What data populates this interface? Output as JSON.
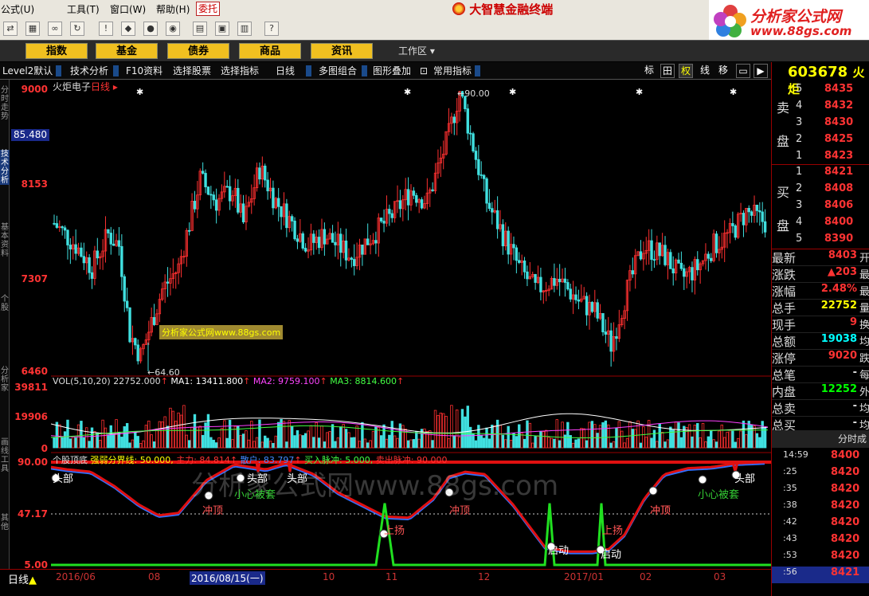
{
  "menu": [
    "公式(U)",
    "工具(T)",
    "窗口(W)",
    "帮助(H)"
  ],
  "entrust_label": "委托",
  "app_title": "大智慧金融终端",
  "logo": {
    "name": "分析家公式网",
    "url": "www.88gs.com"
  },
  "nav": [
    "指数",
    "基金",
    "债券",
    "商品",
    "资讯"
  ],
  "workarea_label": "工作区",
  "tabs": [
    "Level2默认",
    "技术分析",
    "F10资料",
    "选择股票",
    "选择指标",
    "日线",
    "多图组合",
    "图形叠加",
    "常用指标"
  ],
  "right_buttons": [
    "标",
    "田",
    "权",
    "线",
    "移"
  ],
  "side_labels": [
    "分时走势",
    "技术分析",
    "基本资料",
    "个股",
    "分析家",
    "画线工具",
    "其他"
  ],
  "price_axis": [
    "9000",
    "8153",
    "7307",
    "6460"
  ],
  "cursor_value": "85.480",
  "chart_title": "火炬电子",
  "chart_period": "日线",
  "price_markers": {
    "high": "90.00",
    "low": "64.60"
  },
  "watermark_box": "分析家公式网www.88gs.com",
  "vol_header": {
    "name": "VOL(5,10,20)",
    "vol": "22752.000",
    "ma1": "MA1: 13411.800",
    "ma2": "MA2: 9759.100",
    "ma3": "MA3: 8814.600"
  },
  "vol_axis": [
    "39811",
    "19906",
    "0"
  ],
  "ind_header": {
    "name": "个股顶底",
    "line": "强弱分界线: 50.000,",
    "main": "主力: 84.814",
    "retail": "散户: 83.797",
    "buy": "买入脉冲: 5.000,",
    "sell": "卖出脉冲: 90.000"
  },
  "ind_axis": [
    "90.00",
    "47.17",
    "5.00"
  ],
  "big_watermark": "分析家公式网www.88gs.com",
  "ind_labels": [
    {
      "text": "头部",
      "c": "#fff"
    },
    {
      "text": "冲顶",
      "c": "#f55"
    },
    {
      "text": "小心被套",
      "c": "#3c3"
    },
    {
      "text": "头部",
      "c": "#fff"
    },
    {
      "text": "头部",
      "c": "#fff"
    },
    {
      "text": "冲顶",
      "c": "#f55"
    },
    {
      "text": "上扬",
      "c": "#f55"
    },
    {
      "text": "启动",
      "c": "#fff"
    },
    {
      "text": "冲顶",
      "c": "#f55"
    },
    {
      "text": "上扬",
      "c": "#f55"
    },
    {
      "text": "启动",
      "c": "#fff"
    },
    {
      "text": "冲顶",
      "c": "#f55"
    },
    {
      "text": "小心被套",
      "c": "#3c3"
    },
    {
      "text": "头部",
      "c": "#fff"
    }
  ],
  "period_btn": "日线",
  "x_ticks": [
    "2016/06",
    "08",
    "2016/08/15(一)",
    "10",
    "11",
    "12",
    "2017/01",
    "02",
    "03"
  ],
  "stock_code": "603678",
  "stock_name": "火炬",
  "orderbook": {
    "sell_label": [
      "卖",
      "盘"
    ],
    "buy_label": [
      "买",
      "盘"
    ],
    "sells": [
      {
        "lvl": "5",
        "p": "8435"
      },
      {
        "lvl": "4",
        "p": "8432"
      },
      {
        "lvl": "3",
        "p": "8430"
      },
      {
        "lvl": "2",
        "p": "8425"
      },
      {
        "lvl": "1",
        "p": "8423"
      }
    ],
    "buys": [
      {
        "lvl": "1",
        "p": "8421"
      },
      {
        "lvl": "2",
        "p": "8408"
      },
      {
        "lvl": "3",
        "p": "8406"
      },
      {
        "lvl": "4",
        "p": "8400"
      },
      {
        "lvl": "5",
        "p": "8390"
      }
    ]
  },
  "quote": [
    {
      "label": "最新",
      "val": "8403",
      "color": "#f33",
      "suffix": "开"
    },
    {
      "label": "涨跌",
      "val": "▲203",
      "color": "#f33",
      "suffix": "最"
    },
    {
      "label": "涨幅",
      "val": "2.48%",
      "color": "#f33",
      "suffix": "最"
    },
    {
      "label": "总手",
      "val": "22752",
      "color": "#ff0",
      "suffix": "量"
    },
    {
      "label": "现手",
      "val": "9",
      "color": "#f33",
      "suffix": "换"
    },
    {
      "label": "总额",
      "val": "19038",
      "color": "#0ff",
      "suffix": "均"
    },
    {
      "label": "涨停",
      "val": "9020",
      "color": "#f33",
      "suffix": "跌"
    },
    {
      "label": "总笔",
      "val": "-",
      "color": "#ddd",
      "suffix": "每"
    },
    {
      "label": "内盘",
      "val": "12252",
      "color": "#0f0",
      "suffix": "外"
    },
    {
      "label": "总卖",
      "val": "-",
      "color": "#ddd",
      "suffix": "均"
    },
    {
      "label": "总买",
      "val": "-",
      "color": "#ddd",
      "suffix": "均"
    }
  ],
  "timesales_title": "分时成",
  "timesales": [
    {
      "t": "14:59",
      "p": "8400"
    },
    {
      "t": ":25",
      "p": "8420"
    },
    {
      "t": ":35",
      "p": "8420"
    },
    {
      "t": ":38",
      "p": "8420"
    },
    {
      "t": ":42",
      "p": "8420"
    },
    {
      "t": ":43",
      "p": "8420"
    },
    {
      "t": ":53",
      "p": "8420"
    },
    {
      "t": ":56",
      "p": "8421"
    }
  ],
  "colors": {
    "up": "#ff3030",
    "down": "#40e0e0",
    "ma1": "#ffffff",
    "ma2": "#ff40ff",
    "ma3": "#40ff40",
    "main": "#e01010",
    "retail": "#3070ff",
    "pulse": "#20e020"
  }
}
